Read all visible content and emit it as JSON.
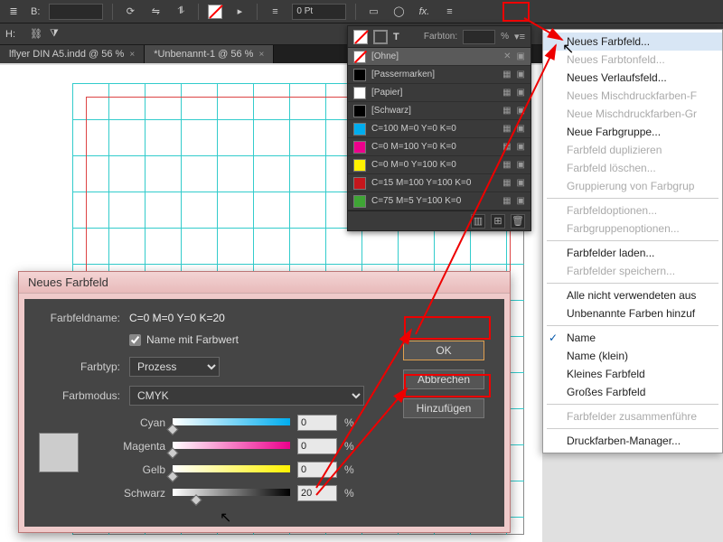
{
  "topbar": {
    "pt_field": "0 Pt"
  },
  "tabs": [
    {
      "label": "lflyer DIN A5.indd @ 56 %"
    },
    {
      "label": "*Unbenannt-1 @ 56 %"
    }
  ],
  "swatch_panel": {
    "tint_label": "Farbton:",
    "tint_unit": "%",
    "rows": [
      {
        "name": "[Ohne]",
        "color": "transparent",
        "none": true,
        "selected": true
      },
      {
        "name": "[Passermarken]",
        "color": "#000"
      },
      {
        "name": "[Papier]",
        "color": "#fff"
      },
      {
        "name": "[Schwarz]",
        "color": "#000"
      },
      {
        "name": "C=100 M=0 Y=0 K=0",
        "color": "#00adee"
      },
      {
        "name": "C=0 M=100 Y=0 K=0",
        "color": "#ec008c"
      },
      {
        "name": "C=0 M=0 Y=100 K=0",
        "color": "#fff200"
      },
      {
        "name": "C=15 M=100 Y=100 K=0",
        "color": "#c4161c"
      },
      {
        "name": "C=75 M=5 Y=100 K=0",
        "color": "#3fa535"
      }
    ]
  },
  "ctxmenu": {
    "items": [
      {
        "label": "Neues Farbfeld...",
        "state": "hover"
      },
      {
        "label": "Neues Farbtonfeld...",
        "state": "disabled"
      },
      {
        "label": "Neues Verlaufsfeld..."
      },
      {
        "label": "Neues Mischdruckfarben-Feld...",
        "state": "disabled",
        "trunc": "Neues Mischdruckfarben-F"
      },
      {
        "label": "Neue Mischdruckfarben-Gruppe...",
        "state": "disabled",
        "trunc": "Neue Mischdruckfarben-Gr"
      },
      {
        "label": "Neue Farbgruppe..."
      },
      {
        "label": "Farbfeld duplizieren",
        "state": "disabled"
      },
      {
        "label": "Farbfeld löschen...",
        "state": "disabled"
      },
      {
        "label": "Gruppierung von Farbgruppe aufheben",
        "state": "disabled",
        "trunc": "Gruppierung von Farbgrup"
      },
      {
        "sep": true
      },
      {
        "label": "Farbfeldoptionen...",
        "state": "disabled"
      },
      {
        "label": "Farbgruppenoptionen...",
        "state": "disabled"
      },
      {
        "sep": true
      },
      {
        "label": "Farbfelder laden..."
      },
      {
        "label": "Farbfelder speichern...",
        "state": "disabled"
      },
      {
        "sep": true
      },
      {
        "label": "Alle nicht verwendeten auswählen",
        "trunc": "Alle nicht verwendeten aus"
      },
      {
        "label": "Unbenannte Farben hinzufügen",
        "trunc": "Unbenannte Farben hinzuf"
      },
      {
        "sep": true
      },
      {
        "label": "Name",
        "checked": true
      },
      {
        "label": "Name (klein)"
      },
      {
        "label": "Kleines Farbfeld"
      },
      {
        "label": "Großes Farbfeld"
      },
      {
        "sep": true
      },
      {
        "label": "Farbfelder zusammenführen",
        "state": "disabled",
        "trunc": "Farbfelder zusammenführe"
      },
      {
        "sep": true
      },
      {
        "label": "Druckfarben-Manager...",
        "trunc": "Druckfarben-Manager..."
      }
    ]
  },
  "dialog": {
    "title": "Neues Farbfeld",
    "name_label": "Farbfeldname:",
    "name_value": "C=0 M=0 Y=0 K=20",
    "name_with_value_label": "Name mit Farbwert",
    "name_with_value_checked": true,
    "type_label": "Farbtyp:",
    "type_value": "Prozess",
    "mode_label": "Farbmodus:",
    "mode_value": "CMYK",
    "sliders": [
      {
        "label": "Cyan",
        "value": "0",
        "gradient": "linear-gradient(90deg,#fff,#00adee)",
        "pos": 0
      },
      {
        "label": "Magenta",
        "value": "0",
        "gradient": "linear-gradient(90deg,#fff,#ec008c)",
        "pos": 0
      },
      {
        "label": "Gelb",
        "value": "0",
        "gradient": "linear-gradient(90deg,#fff,#fff200)",
        "pos": 0
      },
      {
        "label": "Schwarz",
        "value": "20",
        "gradient": "linear-gradient(90deg,#fff,#000)",
        "pos": 20
      }
    ],
    "buttons": {
      "ok": "OK",
      "cancel": "Abbrechen",
      "add": "Hinzufügen"
    },
    "pct": "%"
  }
}
